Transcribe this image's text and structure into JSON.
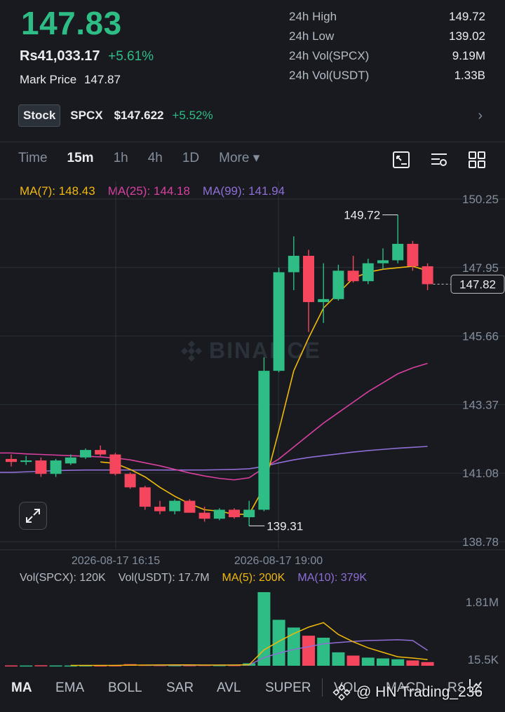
{
  "header": {
    "last_price": "147.83",
    "fiat_price": "Rs41,033.17",
    "change_pct": "+5.61%",
    "mark_label": "Mark Price",
    "mark_value": "147.87"
  },
  "stats": [
    {
      "label": "24h High",
      "value": "149.72"
    },
    {
      "label": "24h Low",
      "value": "139.02"
    },
    {
      "label": "24h Vol(SPCX)",
      "value": "9.19M"
    },
    {
      "label": "24h Vol(USDT)",
      "value": "1.33B"
    }
  ],
  "stock": {
    "badge": "Stock",
    "symbol": "SPCX",
    "price": "$147.622",
    "change": "+5.52%",
    "arrow": "›"
  },
  "timeframes": {
    "items": [
      "Time",
      "15m",
      "1h",
      "4h",
      "1D"
    ],
    "active": "15m",
    "more": "More ▾"
  },
  "toolbar_icons": [
    "chart-style-icon",
    "indicator-settings-icon",
    "grid-layout-icon"
  ],
  "ma_legend": {
    "ma7": "MA(7): 148.43",
    "ma25": "MA(25): 144.18",
    "ma99": "MA(99): 141.94"
  },
  "colors": {
    "up": "#2ebd85",
    "down": "#f6465d",
    "ma7": "#f0b90b",
    "ma25": "#d940a0",
    "ma99": "#8f6ed5",
    "background": "#181a20"
  },
  "watermark": "BINANCE",
  "price_axis_labels": [
    "150.25",
    "147.95",
    "145.66",
    "143.37",
    "141.08",
    "138.78"
  ],
  "current_price_tag": "147.82",
  "high_annotation": "149.72",
  "low_annotation": "139.31",
  "time_labels": [
    "2026-08-17 16:15",
    "2026-08-17 19:00"
  ],
  "volume_legend": {
    "vol_base": "Vol(SPCX): 120K",
    "vol_quote": "Vol(USDT): 17.7M",
    "ma5": "MA(5): 200K",
    "ma10": "MA(10): 379K"
  },
  "volume_axis_labels": [
    "1.81M",
    "15.5K"
  ],
  "indicator_tabs": {
    "items": [
      "MA",
      "EMA",
      "BOLL",
      "SAR",
      "AVL",
      "SUPER",
      "VOL",
      "MACD",
      "RSI"
    ],
    "active": "MA"
  },
  "credit": "@ HN Trading_236",
  "chart_data": {
    "type": "candlestick",
    "interval": "15m",
    "price_range": [
      138.78,
      150.25
    ],
    "candles": [
      {
        "o": 141.55,
        "h": 141.7,
        "l": 141.3,
        "c": 141.45
      },
      {
        "o": 141.45,
        "h": 141.65,
        "l": 141.35,
        "c": 141.5
      },
      {
        "o": 141.5,
        "h": 141.6,
        "l": 140.95,
        "c": 141.05
      },
      {
        "o": 141.05,
        "h": 141.55,
        "l": 140.95,
        "c": 141.5
      },
      {
        "o": 141.4,
        "h": 141.7,
        "l": 141.35,
        "c": 141.6
      },
      {
        "o": 141.6,
        "h": 141.9,
        "l": 141.55,
        "c": 141.85
      },
      {
        "o": 141.85,
        "h": 142.0,
        "l": 141.65,
        "c": 141.7
      },
      {
        "o": 141.7,
        "h": 141.75,
        "l": 141.0,
        "c": 141.05
      },
      {
        "o": 141.05,
        "h": 141.1,
        "l": 140.55,
        "c": 140.6
      },
      {
        "o": 140.6,
        "h": 140.65,
        "l": 139.85,
        "c": 139.95
      },
      {
        "o": 139.95,
        "h": 140.15,
        "l": 139.7,
        "c": 139.8
      },
      {
        "o": 139.8,
        "h": 140.2,
        "l": 139.7,
        "c": 140.15
      },
      {
        "o": 140.15,
        "h": 140.2,
        "l": 139.75,
        "c": 139.75
      },
      {
        "o": 139.75,
        "h": 139.95,
        "l": 139.45,
        "c": 139.55
      },
      {
        "o": 139.55,
        "h": 139.9,
        "l": 139.5,
        "c": 139.85
      },
      {
        "o": 139.85,
        "h": 139.9,
        "l": 139.55,
        "c": 139.6
      },
      {
        "o": 139.6,
        "h": 140.15,
        "l": 139.31,
        "c": 139.85
      },
      {
        "o": 139.85,
        "h": 144.95,
        "l": 139.8,
        "c": 144.5
      },
      {
        "o": 144.5,
        "h": 147.95,
        "l": 144.45,
        "c": 147.8
      },
      {
        "o": 147.8,
        "h": 149.0,
        "l": 147.2,
        "c": 148.35
      },
      {
        "o": 148.35,
        "h": 148.55,
        "l": 145.8,
        "c": 146.8
      },
      {
        "o": 146.8,
        "h": 148.1,
        "l": 146.1,
        "c": 146.9
      },
      {
        "o": 146.9,
        "h": 148.05,
        "l": 146.85,
        "c": 147.85
      },
      {
        "o": 147.85,
        "h": 148.35,
        "l": 147.45,
        "c": 147.5
      },
      {
        "o": 147.5,
        "h": 148.25,
        "l": 147.4,
        "c": 148.1
      },
      {
        "o": 148.1,
        "h": 148.6,
        "l": 147.9,
        "c": 148.2
      },
      {
        "o": 148.2,
        "h": 149.72,
        "l": 148.1,
        "c": 148.75
      },
      {
        "o": 148.75,
        "h": 148.85,
        "l": 147.85,
        "c": 148.0
      },
      {
        "o": 148.0,
        "h": 148.1,
        "l": 147.2,
        "c": 147.4
      }
    ],
    "ma7": [
      null,
      null,
      null,
      null,
      null,
      null,
      141.45,
      141.4,
      141.2,
      140.95,
      140.6,
      140.3,
      140.05,
      139.85,
      139.8,
      139.7,
      139.7,
      140.6,
      142.5,
      144.5,
      145.6,
      146.6,
      147.1,
      147.6,
      147.8,
      147.9,
      147.95,
      148.0,
      147.85
    ],
    "ma25": [
      141.75,
      141.72,
      141.7,
      141.68,
      141.66,
      141.64,
      141.62,
      141.58,
      141.52,
      141.42,
      141.32,
      141.2,
      141.08,
      140.98,
      140.9,
      140.85,
      140.92,
      141.25,
      141.55,
      141.95,
      142.35,
      142.75,
      143.1,
      143.45,
      143.8,
      144.1,
      144.4,
      144.6,
      144.75
    ],
    "ma99": [
      141.1,
      141.12,
      141.14,
      141.16,
      141.17,
      141.18,
      141.18,
      141.18,
      141.18,
      141.18,
      141.18,
      141.18,
      141.18,
      141.18,
      141.19,
      141.2,
      141.22,
      141.3,
      141.42,
      141.52,
      141.6,
      141.66,
      141.72,
      141.78,
      141.83,
      141.87,
      141.91,
      141.94,
      141.97
    ],
    "volume_max": 1810000,
    "volumes": [
      8000,
      6000,
      12000,
      7000,
      6000,
      9000,
      8000,
      10000,
      40000,
      22000,
      18000,
      14000,
      15000,
      20000,
      16000,
      18000,
      60000,
      1810000,
      1130000,
      940000,
      740000,
      690000,
      330000,
      250000,
      200000,
      180000,
      160000,
      130000,
      90000
    ],
    "vol_ma5": [
      null,
      null,
      null,
      null,
      8000,
      8000,
      8000,
      9000,
      15000,
      18000,
      20000,
      21000,
      22000,
      18000,
      17000,
      17000,
      26000,
      390000,
      600000,
      790000,
      950000,
      1060000,
      770000,
      590000,
      440000,
      330000,
      220000,
      190000,
      150000
    ],
    "vol_ma10": [
      null,
      null,
      null,
      null,
      null,
      null,
      null,
      null,
      null,
      12000,
      13000,
      14000,
      14000,
      15000,
      16000,
      18000,
      20000,
      200000,
      310000,
      400000,
      470000,
      540000,
      570000,
      600000,
      620000,
      630000,
      640000,
      620000,
      379000
    ]
  }
}
